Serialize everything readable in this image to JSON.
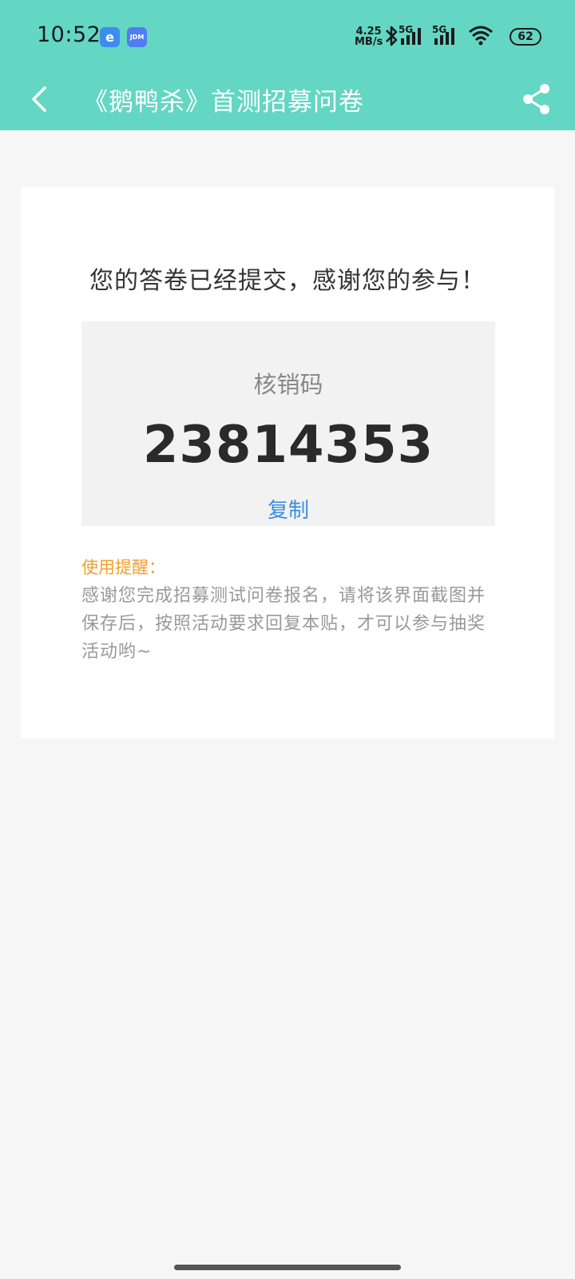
{
  "status_bar": {
    "time": "10:52",
    "app_badge_1": "e",
    "app_badge_2": "JDM",
    "net_speed_value": "4.25",
    "net_speed_unit": "MB/s",
    "signal_1_label": "5G",
    "signal_2_label": "5G",
    "battery": "62",
    "icons": [
      "bluetooth-icon",
      "signal-icon",
      "signal-icon",
      "wifi-icon",
      "battery-icon"
    ]
  },
  "nav": {
    "title": "《鹅鸭杀》首测招募问卷",
    "back_icon": "back-arrow-icon",
    "share_icon": "share-icon"
  },
  "card": {
    "message": "您的答卷已经提交，感谢您的参与！",
    "code_label": "核销码",
    "code_value": "23814353",
    "copy_label": "复制",
    "tip_title": "使用提醒：",
    "tip_body": "感谢您完成招募测试问卷报名，请将该界面截图并保存后，按照活动要求回复本贴，才可以参与抽奖活动哟~"
  },
  "colors": {
    "header": "#63d6c4",
    "copy_link": "#3d8ee0",
    "tip_title": "#f0a030"
  }
}
